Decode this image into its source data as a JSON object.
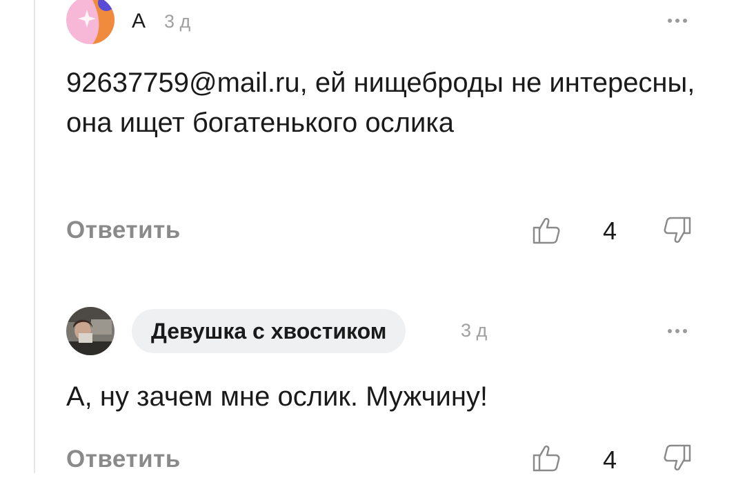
{
  "comments": [
    {
      "author": "А",
      "time": "3 д",
      "text": "92637759@mail.ru, ей нищеброды не интересны, она ищет богатенького ослика",
      "reply_label": "Ответить",
      "score": "4",
      "avatar_icon": "abstract-avatar-icon"
    },
    {
      "author": "Девушка с хвостиком",
      "time": "3 д",
      "text": "А, ну зачем мне ослик. Мужчину!",
      "reply_label": "Ответить",
      "score": "4",
      "avatar_icon": "photo-avatar"
    }
  ],
  "colors": {
    "accent_pink": "#f7b8d8",
    "accent_orange": "#f08a3c",
    "accent_purple": "#5a4bd6",
    "muted_text": "#8a8a8a",
    "pill_bg": "#eef0f2"
  }
}
